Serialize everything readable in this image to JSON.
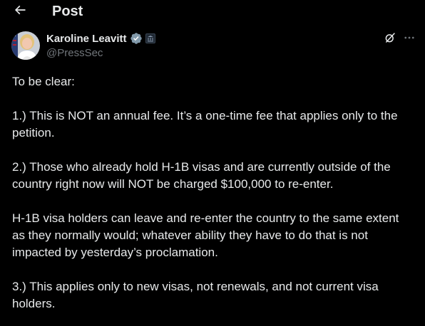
{
  "header": {
    "title": "Post",
    "back_icon": "arrow-left-icon"
  },
  "author": {
    "display_name": "Karoline Leavitt",
    "handle": "@PressSec",
    "verified_icon": "verified-badge-icon",
    "affiliation_icon": "government-affiliation-icon",
    "verified_color": "#829aab"
  },
  "actions": {
    "grok_icon": "grok-icon",
    "more_icon": "more-horizontal-icon"
  },
  "tweet": {
    "paragraphs": [
      "To be clear:",
      "1.) This is NOT an annual fee. It’s a one-time fee that applies only to the\npetition.",
      "2.) Those who already hold H-1B visas and are currently outside of the\ncountry right now will NOT be charged $100,000 to re-enter.",
      "H-1B visa holders can leave and re-enter the country to the same extent\nas they normally would; whatever ability they have to do that is not\nimpacted by yesterday’s proclamation.",
      "3.) This applies only to new visas, not renewals, and not current visa\nholders."
    ]
  },
  "colors": {
    "background": "#000000",
    "text": "#e7e9ea",
    "secondary_text": "#71767b"
  }
}
